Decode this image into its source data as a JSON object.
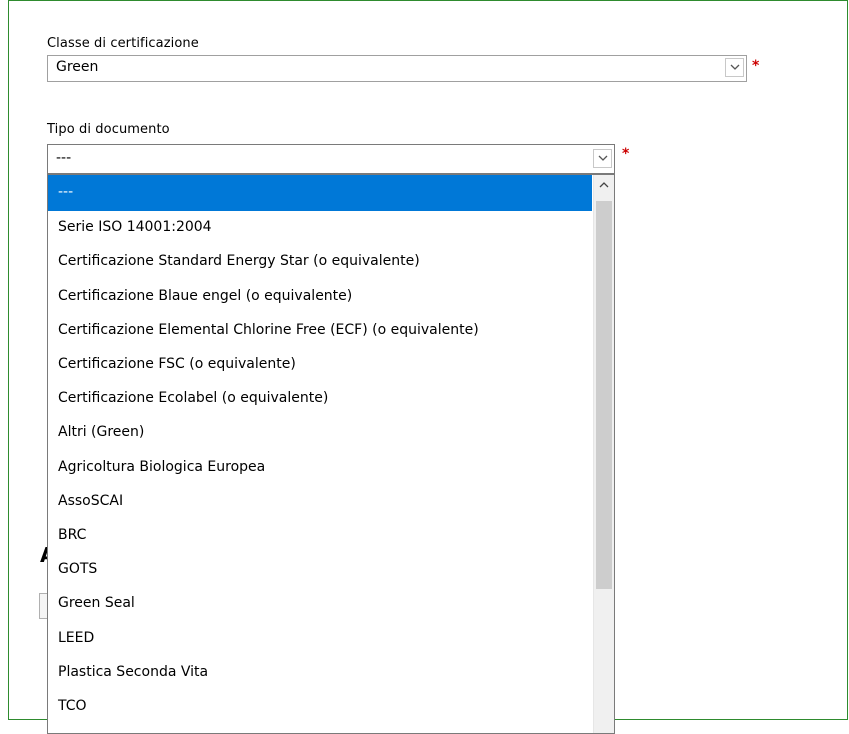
{
  "form": {
    "classe": {
      "label": "Classe di certificazione",
      "value": "Green",
      "required_mark": "*"
    },
    "tipo": {
      "label": "Tipo di documento",
      "value": "---",
      "required_mark": "*"
    },
    "background_fragment": "A"
  },
  "dropdown": {
    "selected_index": 0,
    "options": [
      "---",
      "Serie ISO 14001:2004",
      "Certificazione Standard Energy Star (o equivalente)",
      "Certificazione Blaue engel (o equivalente)",
      "Certificazione Elemental Chlorine Free (ECF) (o equivalente)",
      "Certificazione FSC (o equivalente)",
      "Certificazione Ecolabel (o equivalente)",
      "Altri (Green)",
      "Agricoltura Biologica Europea",
      "AssoSCAI",
      "BRC",
      "GOTS",
      "Green Seal",
      "LEED",
      "Plastica Seconda Vita",
      "TCO"
    ]
  },
  "colors": {
    "selection": "#0078d7",
    "required": "#cc0000",
    "frame_border": "#2e8b2e"
  },
  "icons": {
    "select_arrow": "chevron-down-icon",
    "scroll_up": "chevron-up-icon"
  }
}
